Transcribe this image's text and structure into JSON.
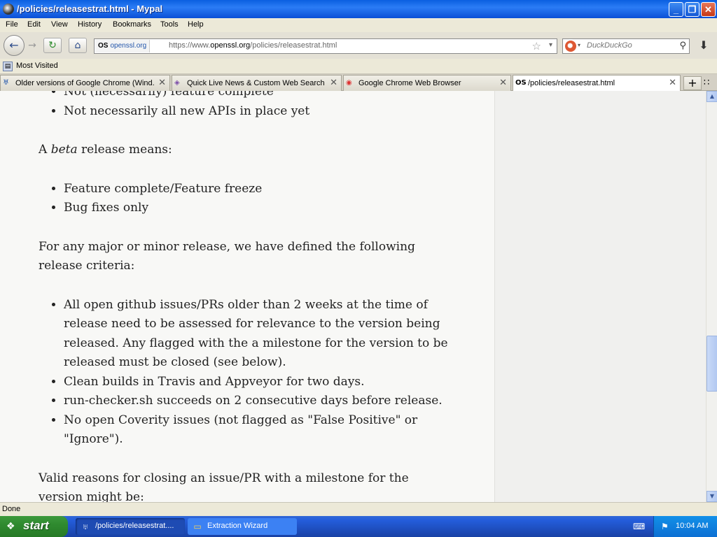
{
  "window": {
    "title": "/policies/releasestrat.html - Mypal",
    "minimize": "_",
    "maximize": "❐",
    "close": "✕"
  },
  "menu": [
    "File",
    "Edit",
    "View",
    "History",
    "Bookmarks",
    "Tools",
    "Help"
  ],
  "nav": {
    "back": "←",
    "forward": "→",
    "reload": "↻",
    "home": "⌂",
    "identity_badge": "OS",
    "identity_site": "openssl.org",
    "url_prefix": "https://www.",
    "url_host": "openssl.org",
    "url_path": "/policies/releasestrat.html",
    "star": "☆",
    "dropmarker": "▾",
    "search_placeholder": "DuckDuckGo",
    "search_dropmarker": "▾",
    "search_go": "⚲",
    "downloads": "⬇"
  },
  "bookmarks": {
    "label": "Most Visited",
    "icon": "▤"
  },
  "tabs": [
    {
      "icon": "♅",
      "label": "Older versions of Google Chrome (Wind...",
      "close": "✕"
    },
    {
      "icon": "◈",
      "label": "Quick Live News & Custom Web Search",
      "close": "✕"
    },
    {
      "icon": "◉",
      "label": "Google Chrome Web Browser",
      "close": "✕"
    },
    {
      "icon": "OS",
      "label": "/policies/releasestrat.html",
      "close": "✕"
    }
  ],
  "tab_new": "+",
  "tab_list": "∷",
  "article": {
    "list_top": [
      "Not (necessarily) feature complete",
      "Not necessarily all new APIs in place yet"
    ],
    "beta_prefix": "A ",
    "beta_em": "beta",
    "beta_suffix": " release means:",
    "list_beta": [
      "Feature complete/Feature freeze",
      "Bug fixes only"
    ],
    "criteria_intro": "For any major or minor release, we have defined the following release criteria:",
    "list_criteria": [
      "All open github issues/PRs older than 2 weeks at the time of release need to be assessed for relevance to the version being released. Any flagged with the a milestone for the version to be released must be closed (see below).",
      "Clean builds in Travis and Appveyor for two days.",
      "run-checker.sh succeeds on 2 consecutive days before release.",
      "No open Coverity issues (not flagged as \"False Positive\" or \"Ignore\")."
    ],
    "closing_intro": "Valid reasons for closing an issue/PR with a milestone for the version might be:"
  },
  "scrollbar": {
    "up": "▲",
    "down": "▼"
  },
  "status": "Done",
  "taskbar": {
    "start": "start",
    "start_logo": "❖",
    "tasks": [
      {
        "icon": "♅",
        "label": "/policies/releasestrat...."
      },
      {
        "icon": "▭",
        "label": "Extraction Wizard"
      }
    ],
    "keyboard_icon": "⌨",
    "tray_icon": "⚑",
    "clock": "10:04 AM"
  }
}
